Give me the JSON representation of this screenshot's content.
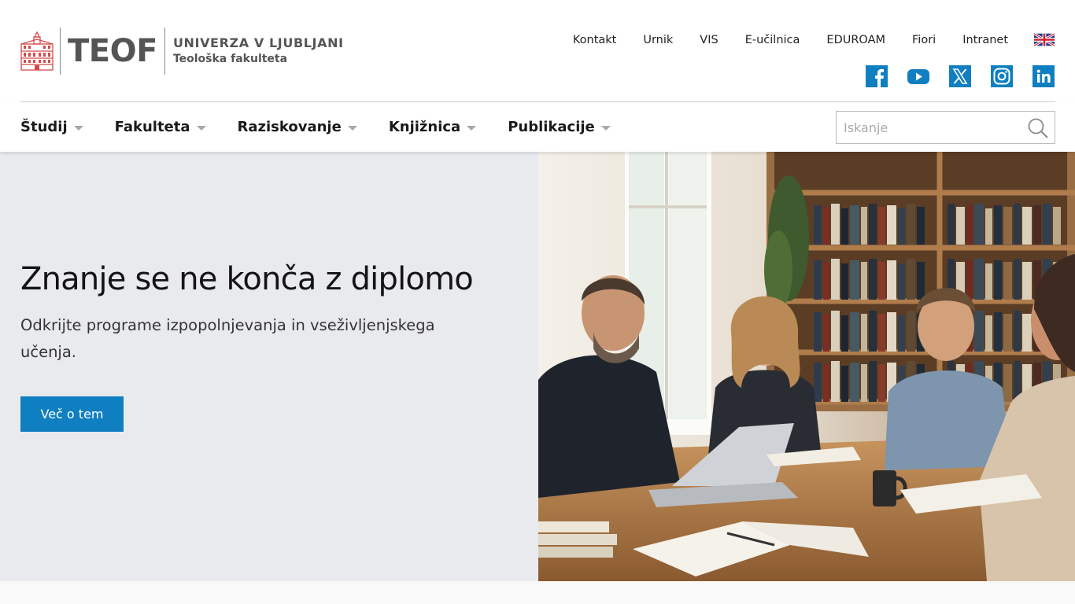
{
  "brand": {
    "short_name": "TEOF",
    "university": "UNIVERZA V LJUBLJANI",
    "faculty": "Teološka fakulteta",
    "logo_color": "#d44a4a"
  },
  "utility_nav": {
    "links": [
      "Kontakt",
      "Urnik",
      "VIS",
      "E-učilnica",
      "EDUROAM",
      "Fiori",
      "Intranet"
    ],
    "language_flag": "uk-flag-icon"
  },
  "social": {
    "color": "#0f7fc1",
    "icons": [
      "facebook-icon",
      "youtube-icon",
      "x-twitter-icon",
      "instagram-icon",
      "linkedin-icon"
    ]
  },
  "main_nav": {
    "items": [
      {
        "label": "Študij"
      },
      {
        "label": "Fakulteta"
      },
      {
        "label": "Raziskovanje"
      },
      {
        "label": "Knjižnica"
      },
      {
        "label": "Publikacije"
      }
    ]
  },
  "search": {
    "placeholder": "Iskanje",
    "value": ""
  },
  "hero": {
    "title": "Znanje se ne konča z diplomo",
    "text": "Odkrijte programe izpopolnjevanja in vseživljenjskega učenja.",
    "button_label": "Več o tem",
    "button_color": "#0f7fc1",
    "background": "#e9eaee"
  }
}
